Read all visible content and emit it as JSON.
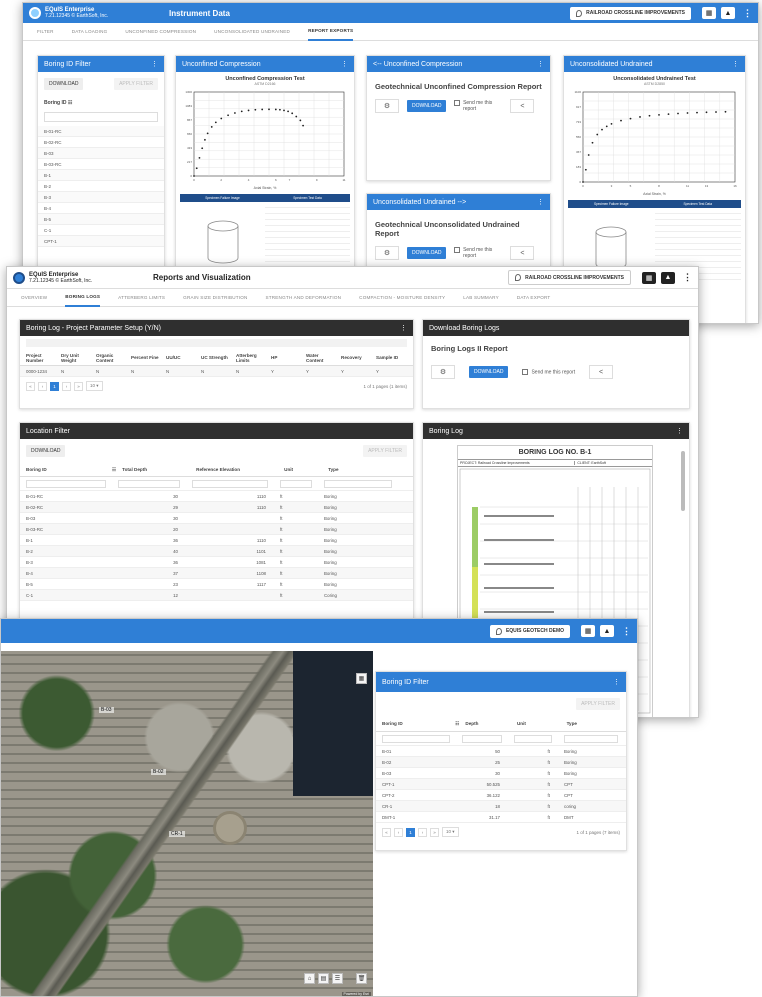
{
  "win1": {
    "brand": "EQuIS Enterprise",
    "brand_sub": "7.21.12345 © EarthSoft, Inc.",
    "title": "Instrument Data",
    "project": "RAILROAD CROSSLINE IMPROVEMENTS",
    "tabs": [
      "FILTER",
      "DATA LOADING",
      "UNCONFINED COMPRESSION",
      "UNCONSOLIDATED UNDRAINED",
      "REPORT EXPORTS"
    ],
    "active_tab": "REPORT EXPORTS",
    "boring_filter": {
      "title": "Boring ID Filter",
      "download": "DOWNLOAD",
      "apply": "APPLY FILTER",
      "column": "Boring ID",
      "items": [
        "B-01-RC",
        "B-02-RC",
        "B-03",
        "B-03-RC",
        "B-1",
        "B-2",
        "B-3",
        "B-4",
        "B-5",
        "C-1",
        "CPT-1"
      ]
    },
    "uc_panel": {
      "title": "Unconfined Compression",
      "chart_title": "Unconfined Compression Test",
      "chart_sub": "ASTM D2166",
      "xlabel": "Axial Strain, %",
      "table_header": [
        "Specimen Failure Image",
        "Specimen Test Data"
      ]
    },
    "uc_report": {
      "title": "<-- Unconfined Compression",
      "heading": "Geotechnical Unconfined Compression Report",
      "download": "DOWNLOAD",
      "send": "Send me this report"
    },
    "uu_report": {
      "title": "Unconsolidated Undrained -->",
      "heading": "Geotechnical Unconsolidated Undrained Report",
      "download": "DOWNLOAD",
      "send": "Send me this report"
    },
    "uu_panel": {
      "title": "Unconsolidated Undrained",
      "chart_title": "Unconsolidated Undrained Test",
      "chart_sub": "ASTM D2850",
      "xlabel": "Axial Strain, %",
      "table_header": [
        "Specimen Failure Image",
        "Specimen Test Data"
      ]
    }
  },
  "win2": {
    "brand": "EQuIS Enterprise",
    "brand_sub": "7.21.12345 © EarthSoft, Inc.",
    "title": "Reports and Visualization",
    "project": "RAILROAD CROSSLINE IMPROVEMENTS",
    "tabs": [
      "OVERVIEW",
      "BORING LOGS",
      "ATTERBERG LIMITS",
      "GRAIN SIZE DISTRIBUTION",
      "STRENGTH AND DEFORMATION",
      "COMPACTION - MOISTURE DENSITY",
      "LAB SUMMARY",
      "DATA EXPORT"
    ],
    "active_tab": "BORING LOGS",
    "param_panel": {
      "title": "Boring Log - Project Parameter Setup (Y/N)",
      "columns": [
        "Project Number",
        "Dry Unit Weight",
        "Organic Content",
        "Percent Fine",
        "UU/UC",
        "UC Strength",
        "Atterberg Limits",
        "HP",
        "Water Content",
        "Recovery",
        "Sample ID"
      ],
      "row": [
        "0000-1234",
        "N",
        "N",
        "N",
        "N",
        "N",
        "N",
        "Y",
        "Y",
        "Y",
        "Y"
      ],
      "page": "1",
      "page_size": "10",
      "pager_text": "1 of 1 pages (1 items)"
    },
    "download_panel": {
      "title": "Download Boring Logs",
      "heading": "Boring Logs II Report",
      "download": "DOWNLOAD",
      "send": "Send me this report"
    },
    "location_filter": {
      "title": "Location Filter",
      "download": "DOWNLOAD",
      "apply": "APPLY FILTER",
      "columns": [
        "Boring ID",
        "Total Depth",
        "Reference Elevation",
        "Unit",
        "Type"
      ],
      "rows": [
        [
          "B-01-RC",
          "30",
          "1110",
          "ft",
          "Boring"
        ],
        [
          "B-02-RC",
          "29",
          "1110",
          "ft",
          "Boring"
        ],
        [
          "B-03",
          "30",
          "",
          "ft",
          "Boring"
        ],
        [
          "B-03-RC",
          "20",
          "",
          "ft",
          "Boring"
        ],
        [
          "B-1",
          "36",
          "1110",
          "ft",
          "Boring"
        ],
        [
          "B-2",
          "40",
          "1101",
          "ft",
          "Boring"
        ],
        [
          "B-3",
          "36",
          "1081",
          "ft",
          "Boring"
        ],
        [
          "B-4",
          "37",
          "1108",
          "ft",
          "Boring"
        ],
        [
          "B-5",
          "23",
          "1117",
          "ft",
          "Boring"
        ],
        [
          "C-1",
          "12",
          "",
          "ft",
          "Coring"
        ]
      ]
    },
    "boring_log": {
      "title": "Boring Log",
      "doc_title": "BORING LOG NO. B-1",
      "doc_project": "PROJECT: Railroad Crossline Improvements",
      "doc_client": "CLIENT: EarthSoft"
    }
  },
  "win3": {
    "project": "EQUIS GEOTECH DEMO",
    "map_labels": [
      "B-03",
      "CR-1",
      "B-02"
    ],
    "attribution": "Powered by Esri",
    "boring_filter": {
      "title": "Boring ID Filter",
      "apply": "APPLY FILTER",
      "columns": [
        "Boring ID",
        "Depth",
        "Unit",
        "Type"
      ],
      "rows": [
        [
          "B-01",
          "50",
          "ft",
          "Boring"
        ],
        [
          "B-02",
          "25",
          "ft",
          "Boring"
        ],
        [
          "B-03",
          "30",
          "ft",
          "Boring"
        ],
        [
          "CPT-1",
          "50.525",
          "ft",
          "CPT"
        ],
        [
          "CPT-2",
          "36.122",
          "ft",
          "CPT"
        ],
        [
          "CR-1",
          "18",
          "ft",
          "coring"
        ],
        [
          "DMT-1",
          "31.17",
          "ft",
          "DMT"
        ]
      ],
      "page": "1",
      "page_size": "10",
      "pager_text": "1 of 1 pages (7 items)"
    }
  },
  "chart_data": [
    {
      "type": "scatter",
      "title": "Unconfined Compression Test",
      "xlabel": "Axial Strain, %",
      "x": [
        0,
        0.2,
        0.4,
        0.6,
        0.8,
        1.0,
        1.3,
        1.6,
        2.0,
        2.5,
        3.0,
        3.5,
        4.0,
        4.5,
        5.0,
        5.5,
        6.0,
        6.3,
        6.6,
        6.9,
        7.2,
        7.5,
        7.8,
        8.0
      ],
      "y": [
        0,
        120,
        280,
        430,
        560,
        660,
        760,
        830,
        890,
        940,
        975,
        1000,
        1015,
        1025,
        1030,
        1032,
        1030,
        1025,
        1015,
        1000,
        970,
        920,
        860,
        780
      ],
      "xlim": [
        0,
        11
      ],
      "ylim": [
        0,
        1300
      ]
    },
    {
      "type": "scatter",
      "title": "Unconsolidated Undrained Test",
      "xlabel": "Axial Strain, %",
      "x": [
        0,
        0.3,
        0.6,
        1.0,
        1.5,
        2.0,
        2.5,
        3.0,
        4.0,
        5.0,
        6.0,
        7.0,
        8.0,
        9.0,
        10.0,
        11.0,
        12.0,
        13.0,
        14.0,
        15.0
      ],
      "y": [
        0,
        150,
        330,
        480,
        580,
        640,
        680,
        710,
        750,
        775,
        795,
        810,
        820,
        830,
        837,
        843,
        848,
        852,
        855,
        858
      ],
      "xlim": [
        0,
        16
      ],
      "ylim": [
        0,
        1100
      ]
    }
  ]
}
